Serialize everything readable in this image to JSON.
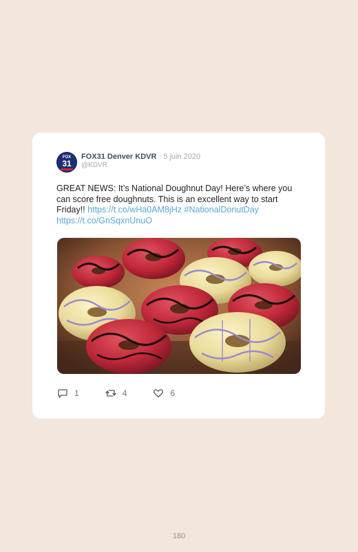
{
  "tweet": {
    "author_name": "FOX31 Denver KDVR",
    "separator": " · ",
    "date": "5 juin 2020",
    "handle": "@KDVR",
    "avatar_text_top": "FOX",
    "avatar_text_num": "31",
    "text_main": "GREAT NEWS: It’s National Doughnut Day! Here’s where you can score free doughnuts. This is an excellent way to start Friday!! ",
    "link_1": "https://t.co/wHa0AM8jHz",
    "hashtag": "#NationalDonutDay",
    "link_2": "https://t.co/GnSqxnUnuO",
    "media_icon": "doughnuts-photo",
    "actions": {
      "reply_icon": "reply-icon",
      "reply_count": "1",
      "retweet_icon": "retweet-icon",
      "retweet_count": "4",
      "like_icon": "heart-icon",
      "like_count": "6"
    }
  },
  "page_number": "180",
  "colors": {
    "background": "#f2e6dd",
    "card": "#ffffff",
    "link": "#5aa6d8",
    "icon": "#4a5a6e"
  }
}
